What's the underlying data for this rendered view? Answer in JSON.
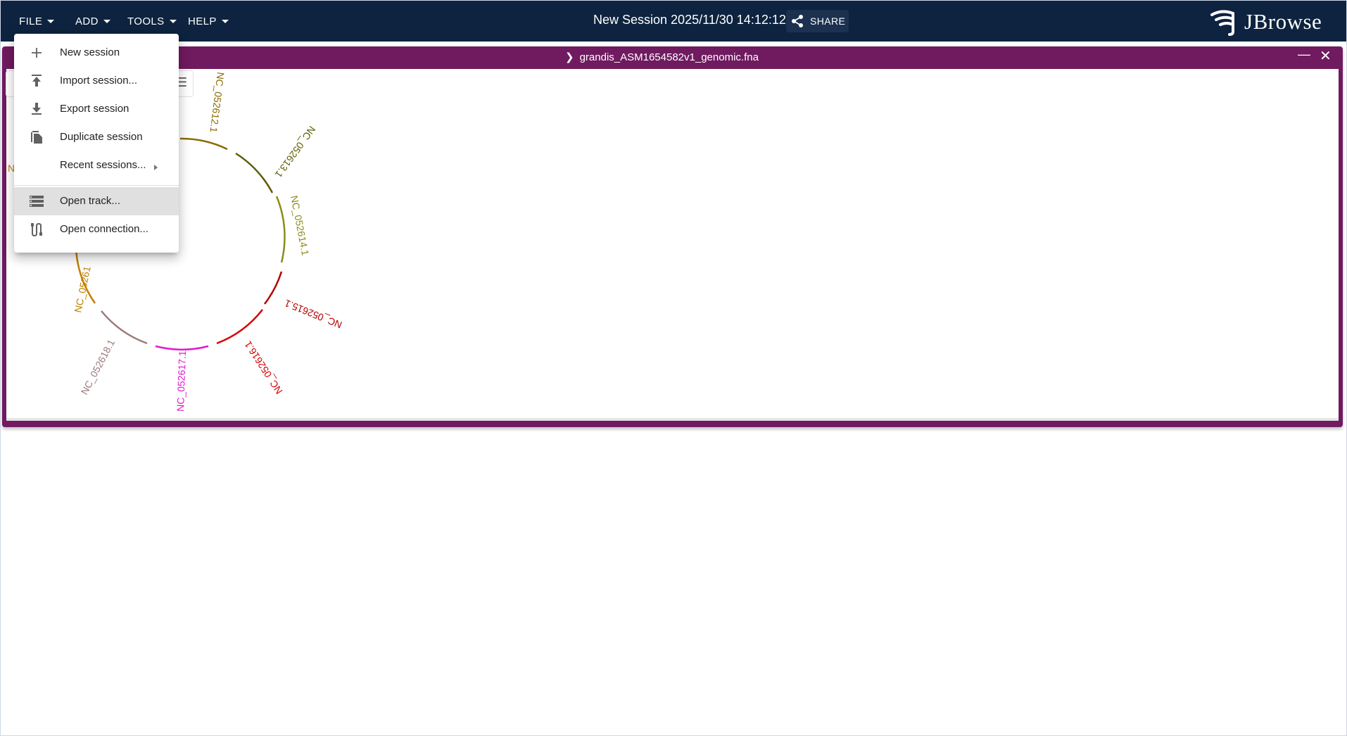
{
  "header": {
    "menus": [
      {
        "label": "FILE"
      },
      {
        "label": "ADD"
      },
      {
        "label": "TOOLS"
      },
      {
        "label": "HELP"
      }
    ],
    "session_title": "New Session 2025/11/30 14:12:12",
    "share_label": "SHARE",
    "logo_text": "JBrowse",
    "background_color": "#0d233f"
  },
  "view": {
    "title": "grandis_ASM1654582v1_genomic.fna",
    "header_color": "#701a60",
    "circular": {
      "labels": [
        {
          "text": "NC_052612.1",
          "color": "#8c6a00"
        },
        {
          "text": "NC_052613.1",
          "color": "#5c5c00"
        },
        {
          "text": "NC_052614.1",
          "color": "#8c8c1a"
        },
        {
          "text": "NC_052615.1",
          "color": "#b30000"
        },
        {
          "text": "NC_052616.1",
          "color": "#d40000"
        },
        {
          "text": "NC_052617.1",
          "color": "#e01ad0"
        },
        {
          "text": "NC_052618.1",
          "color": "#9c7a7a"
        },
        {
          "text": "NC_05261",
          "color": "#c08000"
        },
        {
          "text": "N",
          "color": "#c08000"
        }
      ]
    }
  },
  "file_menu": {
    "items": [
      {
        "label": "New session",
        "icon": "plus-icon"
      },
      {
        "label": "Import session...",
        "icon": "upload-icon"
      },
      {
        "label": "Export session",
        "icon": "download-icon"
      },
      {
        "label": "Duplicate session",
        "icon": "copy-icon"
      },
      {
        "label": "Recent sessions...",
        "icon": "none"
      },
      {
        "label": "Open track...",
        "icon": "track-icon",
        "highlighted": true
      },
      {
        "label": "Open connection...",
        "icon": "connection-icon"
      }
    ]
  }
}
